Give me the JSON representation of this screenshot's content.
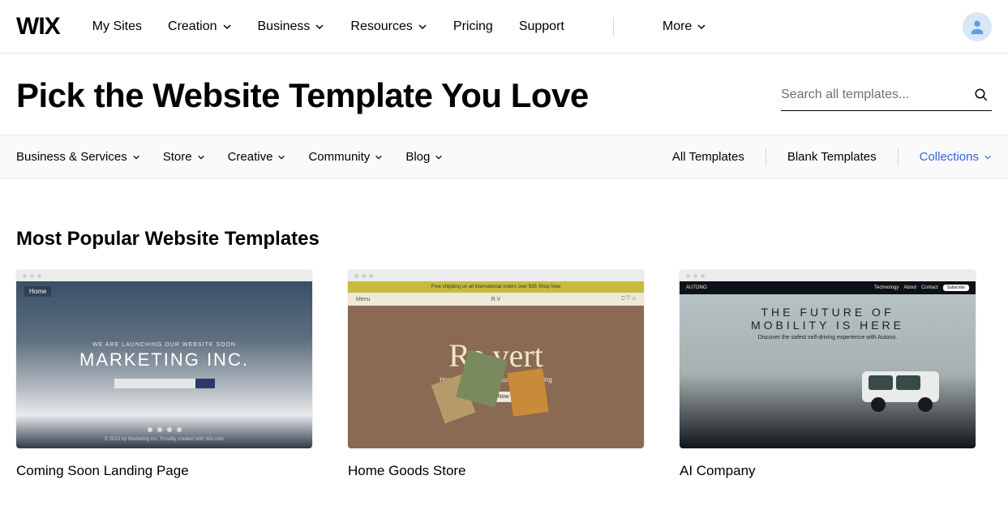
{
  "topnav": {
    "logo": "WIX",
    "items": [
      {
        "label": "My Sites",
        "dropdown": false
      },
      {
        "label": "Creation",
        "dropdown": true
      },
      {
        "label": "Business",
        "dropdown": true
      },
      {
        "label": "Resources",
        "dropdown": true
      },
      {
        "label": "Pricing",
        "dropdown": false
      },
      {
        "label": "Support",
        "dropdown": false
      }
    ],
    "more": {
      "label": "More",
      "dropdown": true
    }
  },
  "hero": {
    "title": "Pick the Website Template You Love",
    "search_placeholder": "Search all templates..."
  },
  "categories": {
    "left": [
      {
        "label": "Business & Services"
      },
      {
        "label": "Store"
      },
      {
        "label": "Creative"
      },
      {
        "label": "Community"
      },
      {
        "label": "Blog"
      }
    ],
    "all_label": "All Templates",
    "blank_label": "Blank Templates",
    "collections_label": "Collections"
  },
  "section": {
    "heading": "Most Popular Website Templates",
    "cards": [
      {
        "title": "Coming Soon Landing Page",
        "thumb": {
          "nav_home": "Home",
          "tagline": "WE ARE LAUNCHING OUR WEBSITE SOON",
          "brand": "MARKETING INC.",
          "footer": "© 2023 by Marketing Inc. Proudly created with Wix.com"
        }
      },
      {
        "title": "Home Goods Store",
        "thumb": {
          "strip": "Free shipping on all international orders over $35 Shop Now",
          "menu": "Menu",
          "logobar": "R.V",
          "brand": "Re.vert",
          "sub": "Home Essentials for Sustainable Living",
          "cta": "Shop Now"
        }
      },
      {
        "title": "AI Company",
        "thumb": {
          "logo": "AUTONO",
          "nav_a": "Technology",
          "nav_b": "About",
          "nav_c": "Contact",
          "nav_d": "Subscribe",
          "line1": "THE FUTURE OF",
          "line2": "MOBILITY IS HERE",
          "sub": "Discover the safest self-driving experience with Autono."
        }
      }
    ]
  }
}
